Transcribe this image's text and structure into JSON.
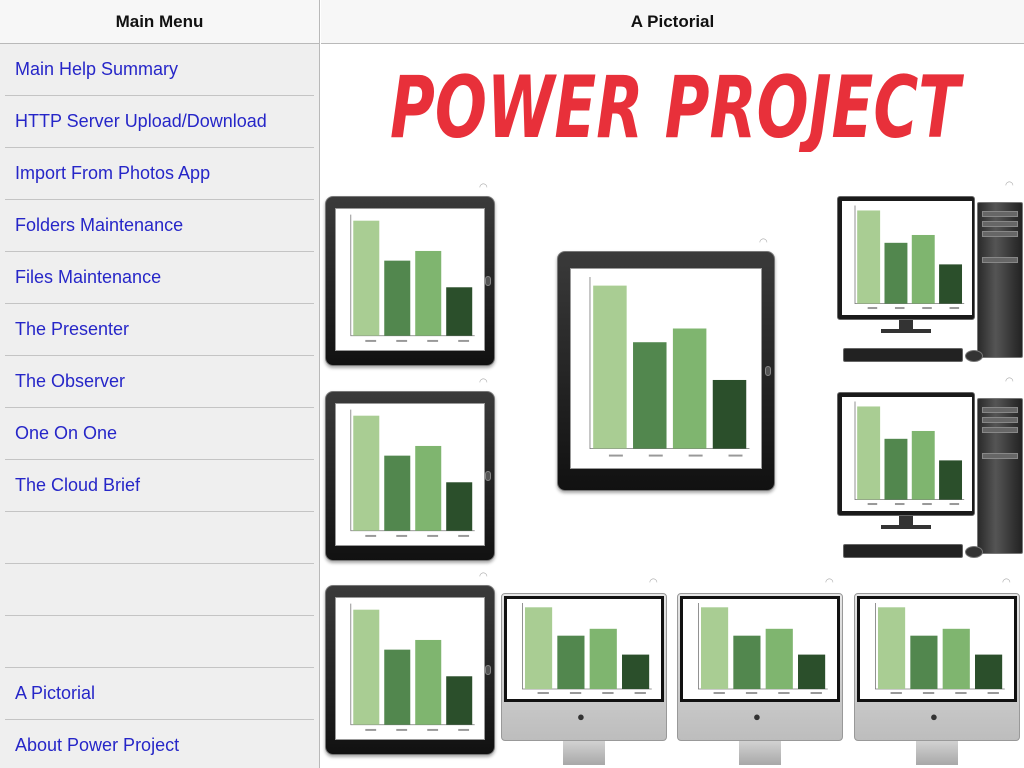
{
  "sidebar": {
    "title": "Main Menu",
    "items": [
      {
        "label": "Main Help Summary"
      },
      {
        "label": "HTTP Server Upload/Download"
      },
      {
        "label": "Import From Photos App"
      },
      {
        "label": "Folders Maintenance"
      },
      {
        "label": "Files Maintenance"
      },
      {
        "label": "The Presenter"
      },
      {
        "label": "The Observer"
      },
      {
        "label": "One On One"
      },
      {
        "label": "The Cloud Brief"
      },
      {
        "label": ""
      },
      {
        "label": ""
      },
      {
        "label": ""
      },
      {
        "label": "A Pictorial"
      },
      {
        "label": "About Power Project"
      }
    ]
  },
  "detail": {
    "title": "A Pictorial",
    "logo_text": "POWER PROJECT",
    "logo_color": "#e8303a"
  },
  "chart_data": {
    "type": "bar",
    "values": [
      95,
      62,
      70,
      40
    ],
    "ylim": [
      0,
      100
    ],
    "colors": [
      "#a9cd93",
      "#52874e",
      "#7fb56f",
      "#2b4f2b"
    ]
  },
  "icons": {
    "wifi": "wifi-icon",
    "apple": "apple-logo-icon"
  }
}
